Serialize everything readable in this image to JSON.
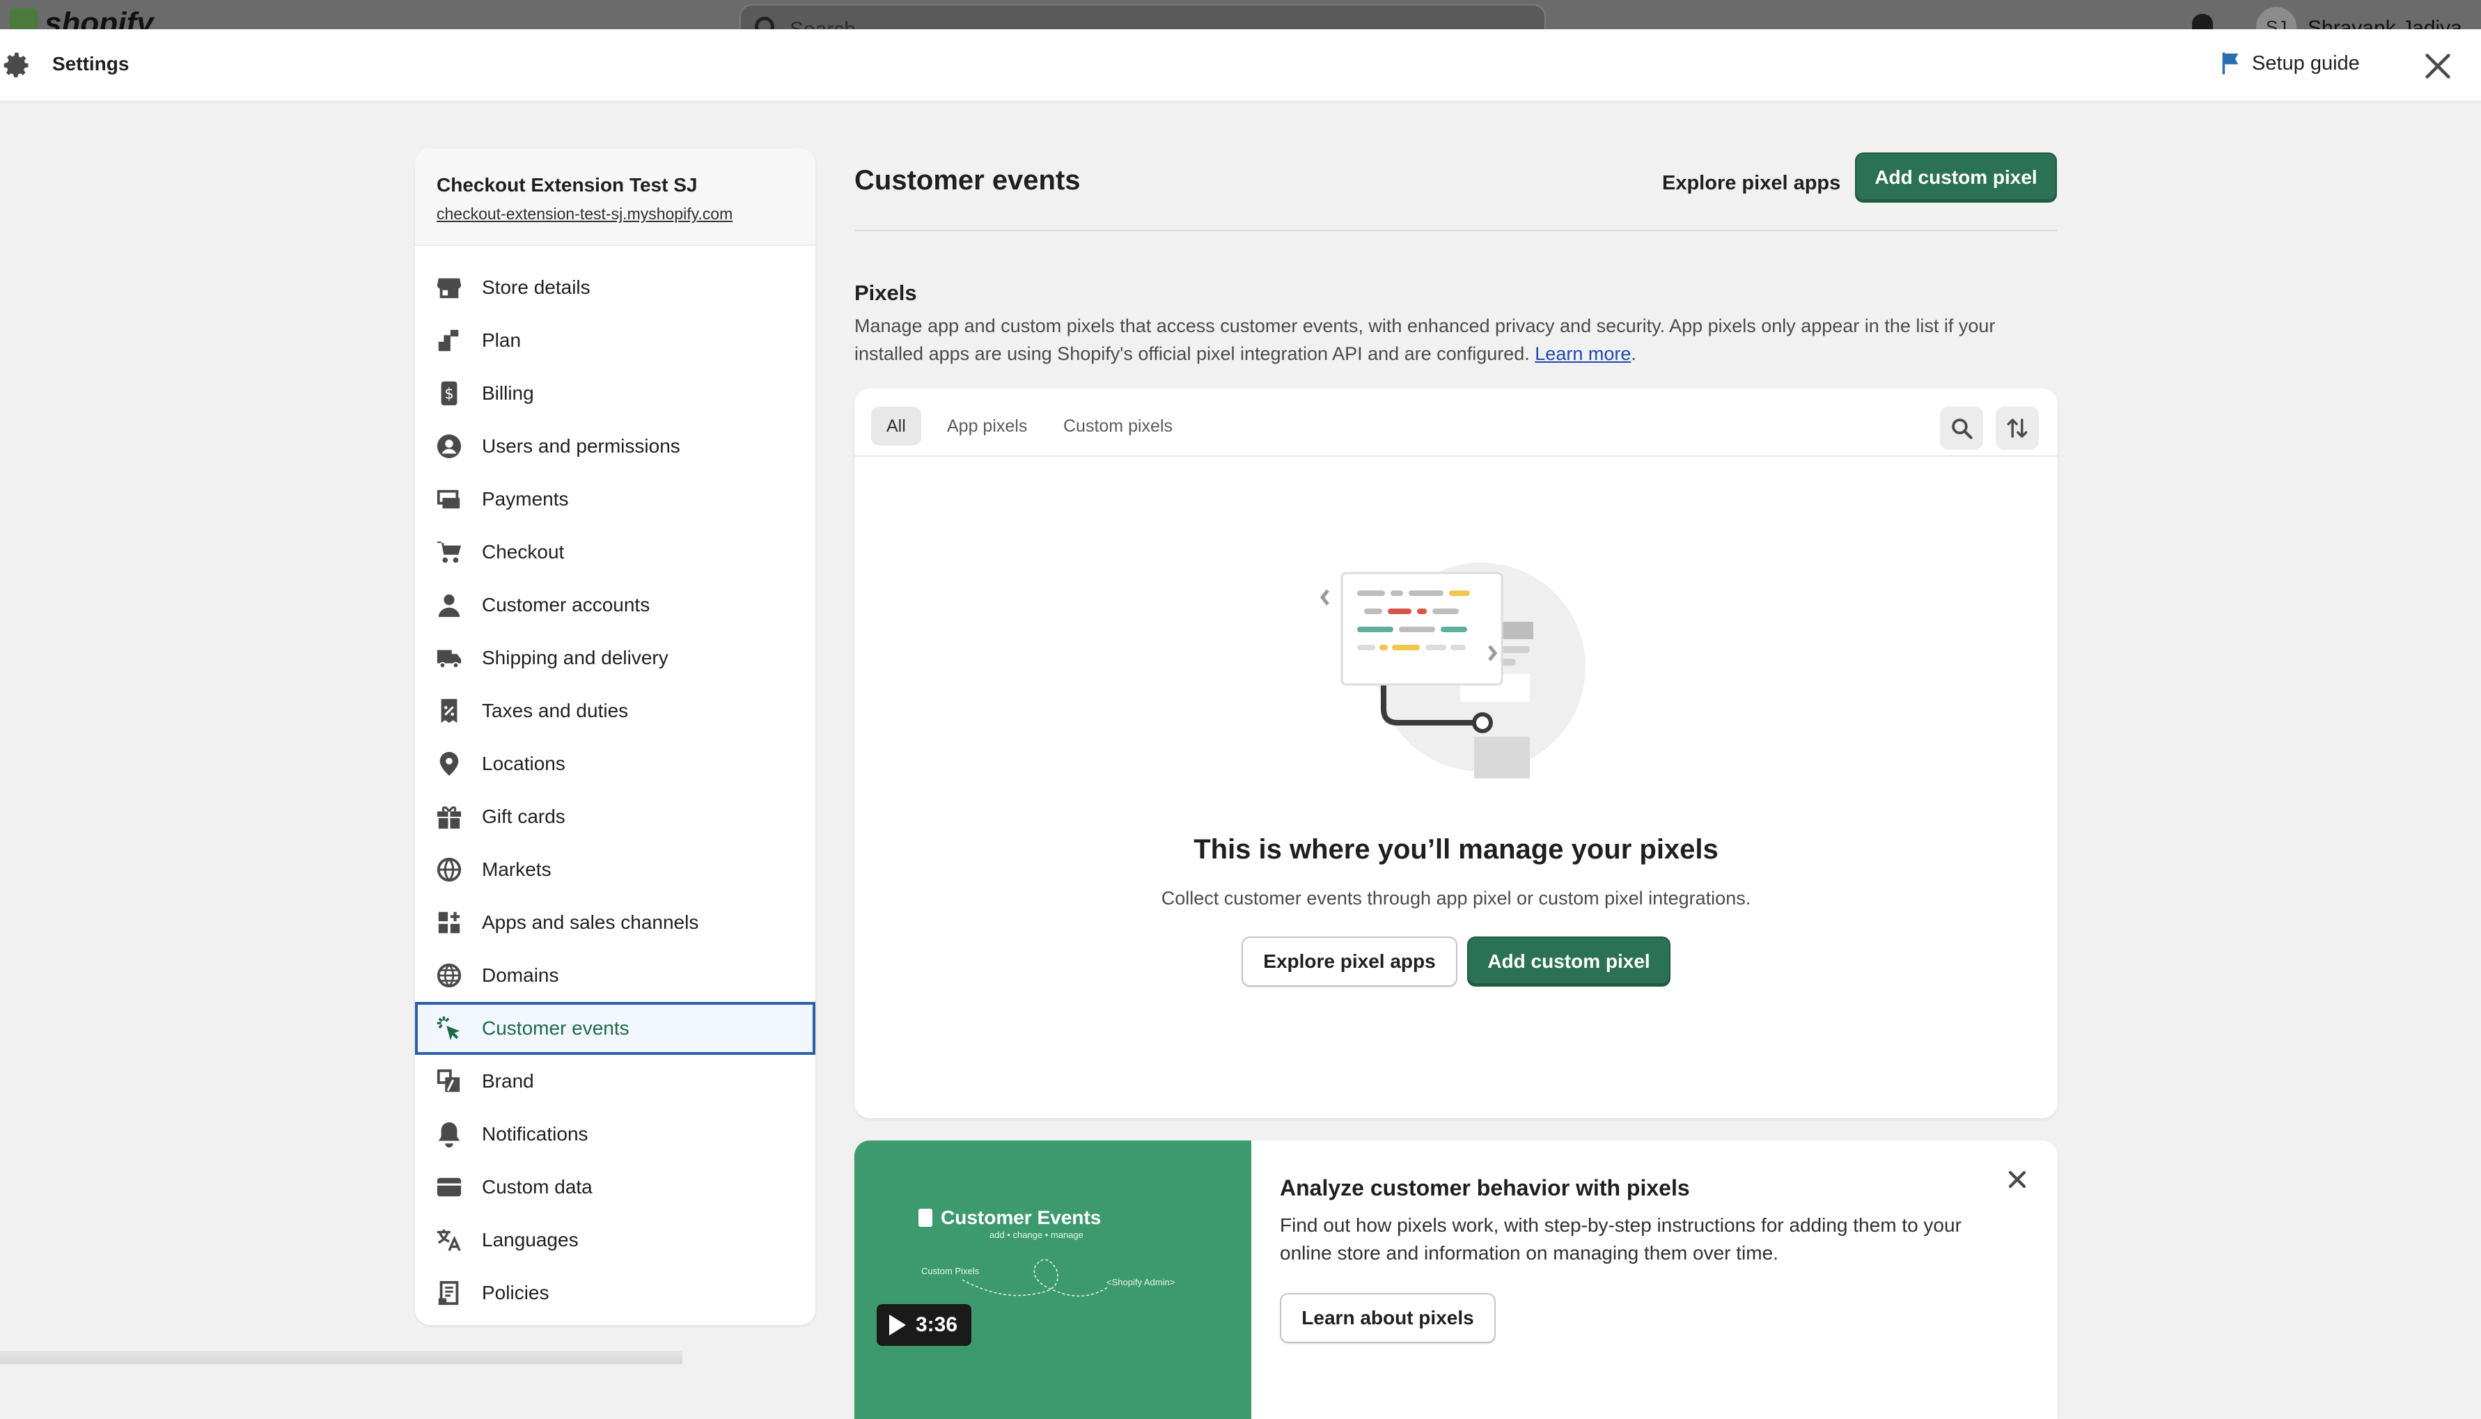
{
  "topbar": {
    "logo_text": "shopify",
    "search_placeholder": "Search",
    "user_initials": "SJ",
    "user_name": "Shravank Jadiya"
  },
  "settings_header": {
    "title": "Settings",
    "setup_guide_label": "Setup guide"
  },
  "store": {
    "name": "Checkout Extension Test SJ",
    "domain": "checkout-extension-test-sj.myshopify.com"
  },
  "nav": {
    "items": [
      {
        "label": "Store details",
        "icon": "store-icon"
      },
      {
        "label": "Plan",
        "icon": "plan-icon"
      },
      {
        "label": "Billing",
        "icon": "billing-icon"
      },
      {
        "label": "Users and permissions",
        "icon": "user-circle-icon"
      },
      {
        "label": "Payments",
        "icon": "credit-card-icon"
      },
      {
        "label": "Checkout",
        "icon": "cart-icon"
      },
      {
        "label": "Customer accounts",
        "icon": "person-icon"
      },
      {
        "label": "Shipping and delivery",
        "icon": "truck-icon"
      },
      {
        "label": "Taxes and duties",
        "icon": "receipt-percent-icon"
      },
      {
        "label": "Locations",
        "icon": "location-pin-icon"
      },
      {
        "label": "Gift cards",
        "icon": "gift-icon"
      },
      {
        "label": "Markets",
        "icon": "markets-globe-icon"
      },
      {
        "label": "Apps and sales channels",
        "icon": "apps-icon"
      },
      {
        "label": "Domains",
        "icon": "globe-icon"
      },
      {
        "label": "Customer events",
        "icon": "cursor-click-icon"
      },
      {
        "label": "Brand",
        "icon": "brand-icon"
      },
      {
        "label": "Notifications",
        "icon": "bell-icon"
      },
      {
        "label": "Custom data",
        "icon": "database-icon"
      },
      {
        "label": "Languages",
        "icon": "translate-icon"
      },
      {
        "label": "Policies",
        "icon": "document-icon"
      }
    ],
    "active": "Customer events"
  },
  "main": {
    "title": "Customer events",
    "explore_label": "Explore pixel apps",
    "add_label": "Add custom pixel",
    "pixels_heading": "Pixels",
    "pixels_desc": "Manage app and custom pixels that access customer events, with enhanced privacy and security. App pixels only appear in the list if your installed apps are using Shopify's official pixel integration API and are configured.",
    "learn_more": "Learn more",
    "tabs": [
      "All",
      "App pixels",
      "Custom pixels"
    ],
    "selected_tab": "All",
    "empty_title": "This is where you’ll manage your pixels",
    "empty_desc": "Collect customer events through app pixel or custom pixel integrations.",
    "empty_explore_label": "Explore pixel apps",
    "empty_add_label": "Add custom pixel"
  },
  "promo": {
    "video_title": "Customer Events",
    "video_subtitle": "add • change • manage",
    "video_label_left": "Custom Pixels",
    "video_label_right": "<Shopify Admin>",
    "duration": "3:36",
    "title": "Analyze customer behavior with pixels",
    "desc": "Find out how pixels work, with step-by-step instructions for adding them to your online store and information on managing them over time.",
    "button_label": "Learn about pixels"
  },
  "colors": {
    "primary": "#2b7156",
    "active_outline": "#2a5fa8",
    "link": "#1f4aa8",
    "promo_green": "#3d9a6f"
  }
}
